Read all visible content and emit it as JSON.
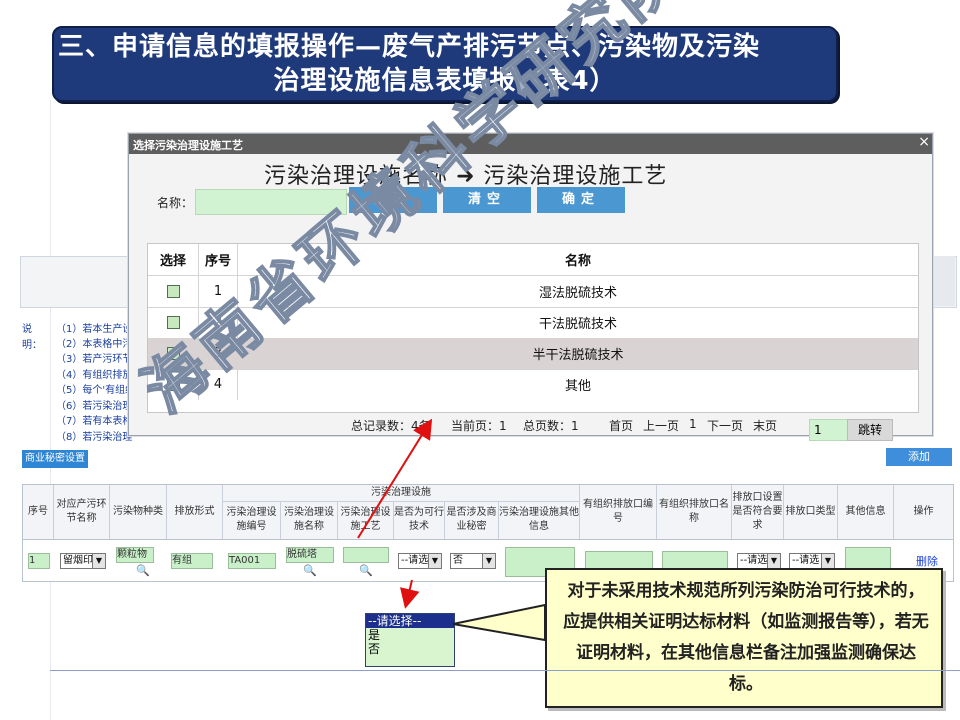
{
  "slide": {
    "title_line1": "三、申请信息的填报操作—废气产排污节点、污染物及污染",
    "title_line2": "治理设施信息表填报（表4）"
  },
  "modal": {
    "title": "选择污染治理设施工艺",
    "close": "×",
    "heading": "污染治理设施名称  ➜  污染治理设施工艺",
    "name_label": "名称：",
    "name_value": "",
    "btn_query": "查询",
    "btn_clear": "清空",
    "btn_confirm": "确定",
    "columns": [
      "选择",
      "序号",
      "名称"
    ],
    "rows": [
      {
        "no": "1",
        "name": "湿法脱硫技术"
      },
      {
        "no": "2",
        "name": "干法脱硫技术"
      },
      {
        "no": "3",
        "name": "半干法脱硫技术"
      },
      {
        "no": "4",
        "name": "其他"
      }
    ],
    "pager": {
      "records": "总记录数：4条",
      "current": "当前页：1",
      "pages": "总页数：1",
      "first": "首页",
      "prev": "上一页",
      "page_no": "1",
      "next": "下一页",
      "last": "末页",
      "goto_value": "1",
      "goto": "跳转"
    }
  },
  "background_form": {
    "notes_label": "说明：",
    "notes": [
      "（1）若本生产设",
      "（2）本表格中污",
      "（3）若产污环节",
      "（4）有组织排放",
      "（5）每个'有组织",
      "（6）若污染治理",
      "（7）若有本表格",
      "（8）若污染治理"
    ],
    "btn_trade_secret": "商业秘密设置",
    "btn_add": "添加",
    "headers": {
      "seq": "序号",
      "link": "对应产污环节名称",
      "pollutant": "污染物种类",
      "emission_form": "排放形式",
      "group": "污染治理设施",
      "fac_no": "污染治理设施编号",
      "fac_name": "污染治理设施名称",
      "fac_tech": "污染治理设施工艺",
      "feasible": "是否为可行技术",
      "secret": "是否涉及商业秘密",
      "other": "污染治理设施其他信息",
      "outlet_no": "有组织排放口编号",
      "outlet_name": "有组织排放口名称",
      "outlet_req": "排放口设置是否符合要求",
      "outlet_type": "排放口类型",
      "other_info": "其他信息",
      "ops": "操作"
    },
    "row": {
      "seq": "1",
      "link": "留烟印",
      "pollutant": "颗粒物",
      "emission_form": "有组",
      "fac_no": "TA001",
      "fac_name": "脱硫塔",
      "feasible": "--请选",
      "secret": "否",
      "outlet_req": "--请选",
      "outlet_type": "--请选",
      "delete": "删除"
    },
    "dropdown_options": [
      "--请选择--",
      "是",
      "否"
    ]
  },
  "callout": {
    "text": "对于未采用技术规范所列污染防治可行技术的，应提供相关证明达标材料（如监测报告等），若无证明材料，在其他信息栏备注加强监测确保达标。"
  },
  "watermark": "海南省环境科学研究院制",
  "colors": {
    "title_bg": "#1f3a7a",
    "button_blue": "#4a97d2",
    "input_green": "#d2f3d2",
    "callout_bg": "#ffffcc",
    "arrow_red": "#e01010",
    "dropdown_highlight": "#1c2f8c"
  }
}
